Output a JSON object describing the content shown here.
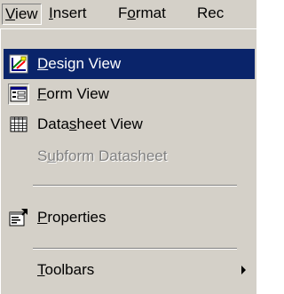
{
  "menubar": {
    "items": [
      {
        "before": "",
        "u": "V",
        "after": "iew"
      },
      {
        "before": "",
        "u": "I",
        "after": "nsert"
      },
      {
        "before": "F",
        "u": "o",
        "after": "rmat"
      },
      {
        "before": "Rec",
        "u": "",
        "after": ""
      }
    ]
  },
  "menu": {
    "items": [
      {
        "before": "",
        "u": "D",
        "after": "esign View",
        "icon": "design-view-icon",
        "state": "selected"
      },
      {
        "before": "",
        "u": "F",
        "after": "orm View",
        "icon": "form-view-icon",
        "state": "checked"
      },
      {
        "before": "Data",
        "u": "s",
        "after": "heet View",
        "icon": "datasheet-view-icon",
        "state": "normal"
      },
      {
        "before": "S",
        "u": "u",
        "after": "bform Datasheet",
        "icon": "",
        "state": "disabled"
      },
      {
        "before": "",
        "u": "P",
        "after": "roperties",
        "icon": "properties-icon",
        "state": "normal"
      },
      {
        "before": "",
        "u": "T",
        "after": "oolbars",
        "icon": "",
        "state": "normal",
        "submenu": true
      }
    ]
  },
  "colors": {
    "face": "#d4d0c8",
    "highlight": "#0a246a",
    "highlight_text": "#ffffff",
    "disabled_text": "#808080"
  }
}
